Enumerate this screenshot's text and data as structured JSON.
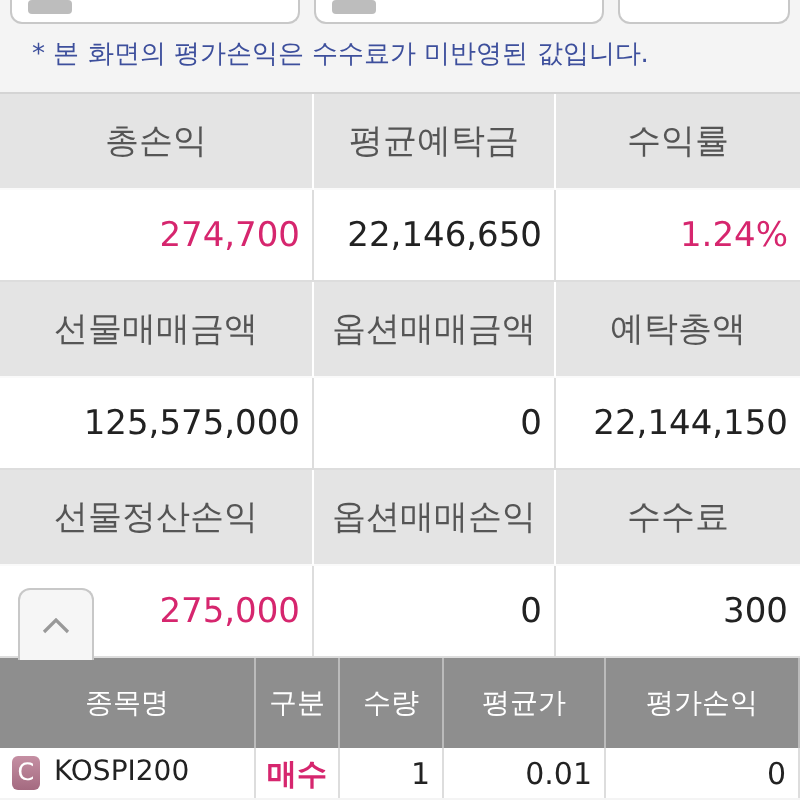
{
  "top_buttons": [
    {
      "kind": "dropdown"
    },
    {
      "kind": "dropdown"
    },
    {
      "kind": "button"
    }
  ],
  "notice": "* 본 화면의 평가손익은 수수료가 미반영된 값입니다.",
  "summary": [
    {
      "label": "총손익",
      "value": "274,700",
      "color": "#d6266e"
    },
    {
      "label": "평균예탁금",
      "value": "22,146,650",
      "color": "#222222"
    },
    {
      "label": "수익률",
      "value": "1.24%",
      "color": "#d6266e"
    },
    {
      "label": "선물매매금액",
      "value": "125,575,000",
      "color": "#222222"
    },
    {
      "label": "옵션매매금액",
      "value": "0",
      "color": "#222222"
    },
    {
      "label": "예탁총액",
      "value": "22,144,150",
      "color": "#222222"
    },
    {
      "label": "선물정산손익",
      "value": "275,000",
      "color": "#d6266e"
    },
    {
      "label": "옵션매매손익",
      "value": "0",
      "color": "#222222"
    },
    {
      "label": "수수료",
      "value": "300",
      "color": "#222222"
    }
  ],
  "positions": {
    "columns": [
      "종목명",
      "구분",
      "수량",
      "평균가",
      "평가손익"
    ],
    "rows": [
      {
        "badge": "C",
        "name": "KOSPI200",
        "side": "매수",
        "color": "#d6266e",
        "quantity": "1",
        "avg_price": "0.01",
        "pnl": "0"
      }
    ]
  }
}
